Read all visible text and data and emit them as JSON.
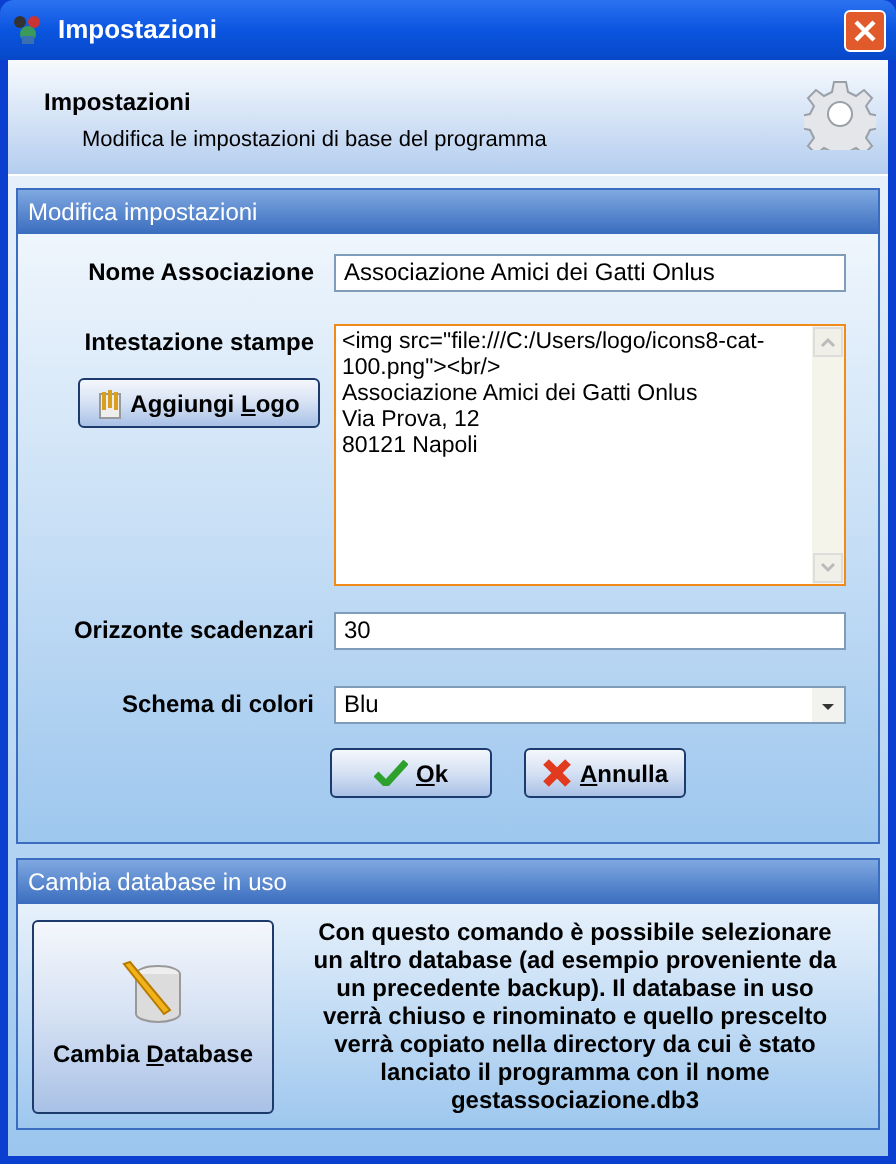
{
  "window": {
    "title": "Impostazioni"
  },
  "header": {
    "title": "Impostazioni",
    "subtitle": "Modifica le impostazioni di base del programma"
  },
  "settings_group": {
    "title": "Modifica impostazioni",
    "name_field": {
      "label": "Nome Associazione",
      "value": "Associazione Amici dei Gatti Onlus"
    },
    "print_header": {
      "label": "Intestazione stampe",
      "lines": [
        "<img src=\"file:///C:/Users/logo/icons8-cat-",
        "100.png\"><br/>",
        "Associazione Amici dei Gatti Onlus",
        "Via Prova, 12",
        "80121 Napoli"
      ],
      "focused": true
    },
    "add_logo_button": {
      "label_parts": [
        "Aggiungi ",
        "L",
        "ogo"
      ]
    },
    "horizon_field": {
      "label": "Orizzonte scadenzari",
      "value": "30"
    },
    "color_scheme": {
      "label": "Schema di colori",
      "value": "Blu"
    },
    "buttons": [
      {
        "kind": "ok",
        "label_parts": [
          "O",
          "k"
        ]
      },
      {
        "kind": "cancel",
        "label_parts": [
          "A",
          "nnulla"
        ]
      }
    ]
  },
  "database_group": {
    "title": "Cambia database in uso",
    "button": {
      "label_parts": [
        "Cambia ",
        "D",
        "atabase"
      ]
    },
    "description": "Con questo comando è possibile selezionare un altro database (ad esempio proveniente da un precedente backup). Il database in uso verrà chiuso e rinominato e quello prescelto verrà copiato nella directory da cui è stato lanciato il programma con il nome gestassociazione.db3"
  }
}
